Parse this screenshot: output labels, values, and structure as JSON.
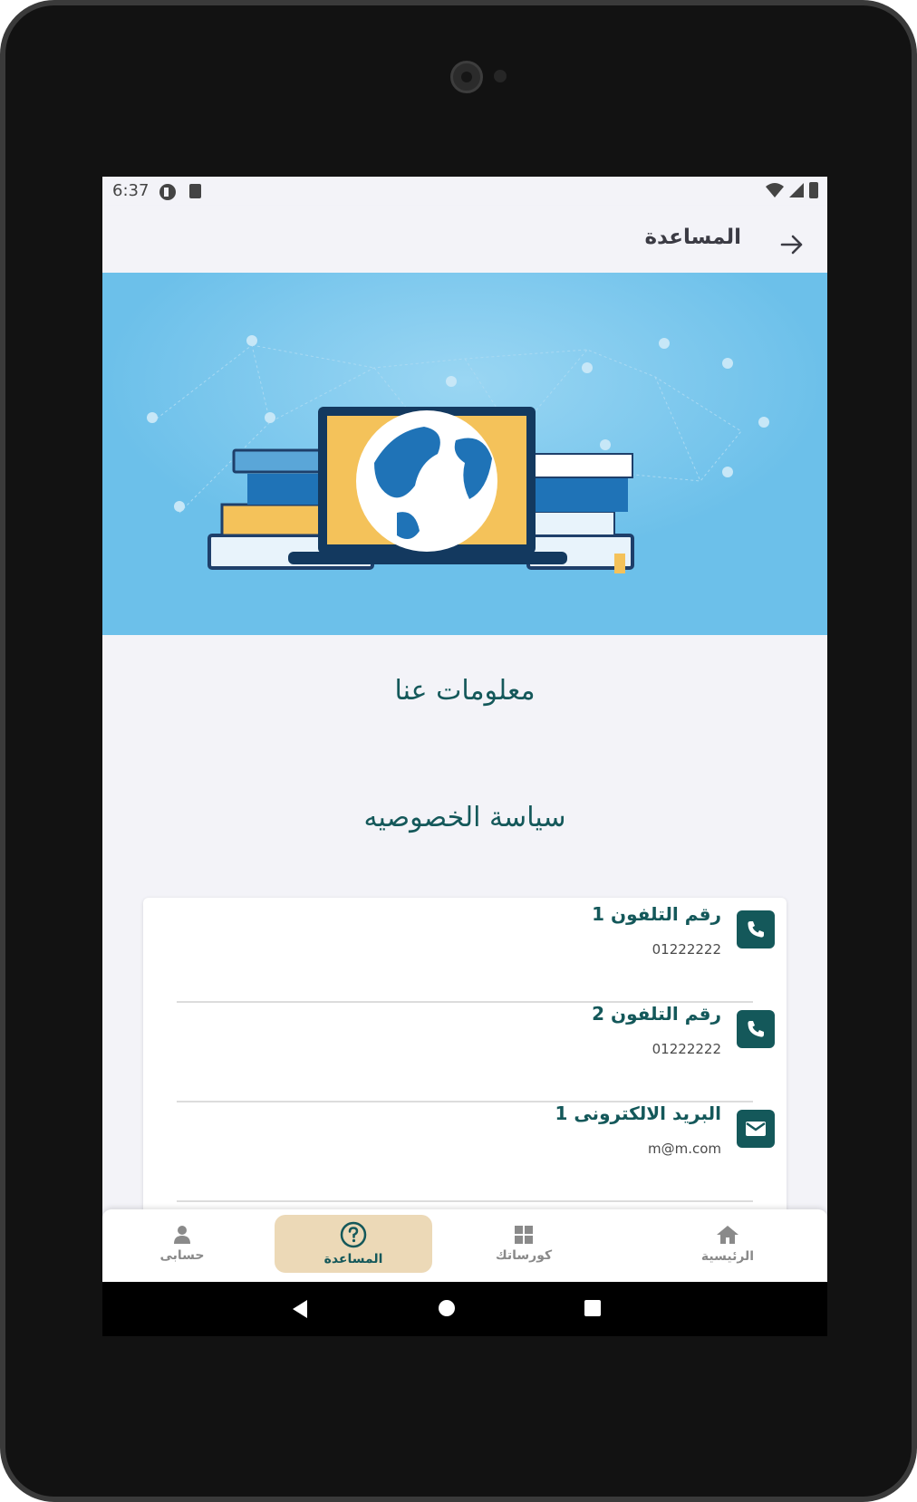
{
  "status": {
    "time": "6:37"
  },
  "appbar": {
    "title": "المساعدة",
    "back_icon": "arrow-right-icon"
  },
  "links": {
    "about": "معلومات عنا",
    "privacy": "سياسة الخصوصيه"
  },
  "contacts": [
    {
      "label": "رقم التلفون 1",
      "value": "01222222",
      "icon": "phone-icon"
    },
    {
      "label": "رقم التلفون 2",
      "value": "01222222",
      "icon": "phone-icon"
    },
    {
      "label": "البريد الالكترونى 1",
      "value": "m@m.com",
      "icon": "mail-icon"
    }
  ],
  "bottom_nav": [
    {
      "label": "الرئيسية",
      "icon": "home-icon",
      "active": false
    },
    {
      "label": "كورساتك",
      "icon": "grid-icon",
      "active": false
    },
    {
      "label": "المساعدة",
      "icon": "help-circle-icon",
      "active": true
    },
    {
      "label": "حسابى",
      "icon": "person-icon",
      "active": false
    }
  ],
  "colors": {
    "primary": "#14585a",
    "active_nav_bg": "#ecd9b7",
    "hero_bg": "#6cc0ea"
  }
}
